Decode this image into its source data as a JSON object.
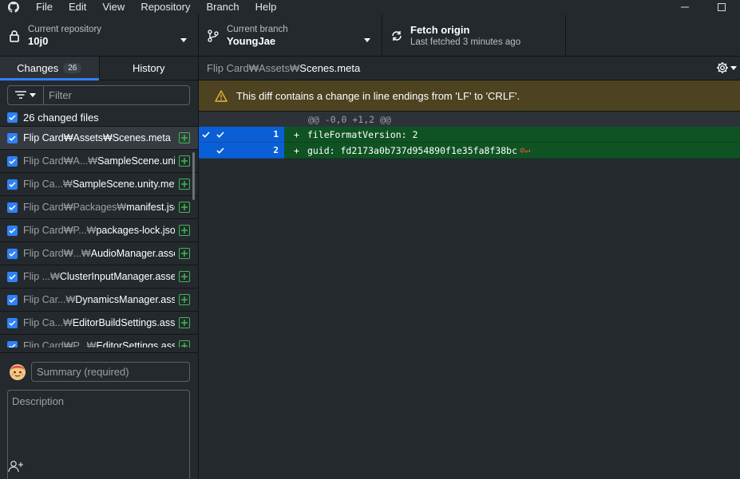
{
  "app": {
    "menu": [
      "File",
      "Edit",
      "View",
      "Repository",
      "Branch",
      "Help"
    ]
  },
  "toolbar": {
    "repo_label": "Current repository",
    "repo_value": "10j0",
    "branch_label": "Current branch",
    "branch_value": "YoungJae",
    "fetch_label": "Fetch origin",
    "fetch_sub": "Last fetched 3 minutes ago"
  },
  "sidebar": {
    "tabs": {
      "changes": "Changes",
      "changes_count": "26",
      "history": "History"
    },
    "filter_placeholder": "Filter",
    "changed_files_label": "26 changed files",
    "files": [
      {
        "dir": "Flip Card₩Assets₩",
        "name": "Scenes.meta"
      },
      {
        "dir": "Flip Card₩A...₩",
        "name": "SampleScene.unity"
      },
      {
        "dir": "Flip Ca...₩",
        "name": "SampleScene.unity.meta"
      },
      {
        "dir": "Flip Card₩Packages₩",
        "name": "manifest.json"
      },
      {
        "dir": "Flip Card₩P...₩",
        "name": "packages-lock.json"
      },
      {
        "dir": "Flip Card₩...₩",
        "name": "AudioManager.asset"
      },
      {
        "dir": "Flip ...₩",
        "name": "ClusterInputManager.asset"
      },
      {
        "dir": "Flip Car...₩",
        "name": "DynamicsManager.asset"
      },
      {
        "dir": "Flip Ca...₩",
        "name": "EditorBuildSettings.asset"
      },
      {
        "dir": "Flip Card₩P...₩",
        "name": "EditorSettings.asset"
      }
    ],
    "summary_placeholder": "Summary (required)",
    "description_placeholder": "Description"
  },
  "diff": {
    "path_dir": "Flip Card₩Assets₩",
    "path_name": "Scenes.meta",
    "warning": "This diff contains a change in line endings from 'LF' to 'CRLF'.",
    "hunk_header": "@@ -0,0 +1,2 @@",
    "lines": [
      {
        "number": "1",
        "marker": "+",
        "text": "fileFormatVersion: 2"
      },
      {
        "number": "2",
        "marker": "+",
        "text": "guid: fd2173a0b737d954890f1e35fa8f38bc"
      }
    ]
  },
  "colors": {
    "accent": "#2f81f7",
    "added": "#3fb950",
    "warning_bg": "#4d4321",
    "diff_added_bg": "#0f5323"
  }
}
